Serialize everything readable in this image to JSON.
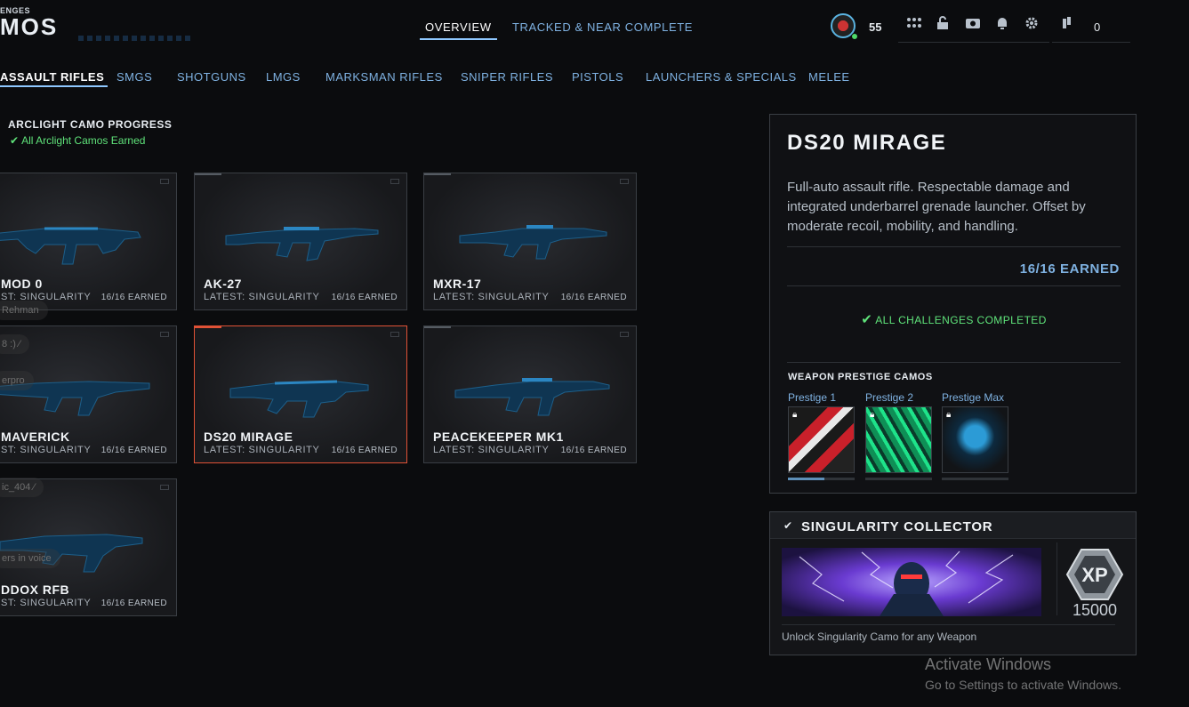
{
  "header": {
    "brand_top": "ENGES",
    "brand_main": "MOS",
    "tabs": [
      {
        "label": "OVERVIEW",
        "active": true
      },
      {
        "label": "TRACKED & NEAR COMPLETE",
        "active": false
      }
    ],
    "level": "55",
    "points": "0",
    "icons": [
      "profile-avatar",
      "grid-icon",
      "lock-open-icon",
      "camera-icon",
      "bell-icon",
      "gear-icon",
      "points-icon"
    ]
  },
  "categories": [
    {
      "label": "ASSAULT RIFLES",
      "active": true
    },
    {
      "label": "SMGS",
      "active": false
    },
    {
      "label": "SHOTGUNS",
      "active": false
    },
    {
      "label": "LMGS",
      "active": false
    },
    {
      "label": "MARKSMAN RIFLES",
      "active": false
    },
    {
      "label": "SNIPER RIFLES",
      "active": false
    },
    {
      "label": "PISTOLS",
      "active": false
    },
    {
      "label": "LAUNCHERS & SPECIALS",
      "active": false
    },
    {
      "label": "MELEE",
      "active": false
    }
  ],
  "progress": {
    "title": "ARCLIGHT CAMO PROGRESS",
    "status": "All Arclight Camos Earned"
  },
  "weapons": [
    {
      "name": "MOD 0",
      "latest": "ST: SINGULARITY",
      "earned": "16/16 EARNED"
    },
    {
      "name": "AK-27",
      "latest": "LATEST: SINGULARITY",
      "earned": "16/16 EARNED"
    },
    {
      "name": "MXR-17",
      "latest": "LATEST: SINGULARITY",
      "earned": "16/16 EARNED"
    },
    {
      "name": "MAVERICK",
      "latest": "ST: SINGULARITY",
      "earned": "16/16 EARNED"
    },
    {
      "name": "DS20 MIRAGE",
      "latest": "LATEST: SINGULARITY",
      "earned": "16/16 EARNED",
      "selected": true
    },
    {
      "name": "PEACEKEEPER MK1",
      "latest": "LATEST: SINGULARITY",
      "earned": "16/16 EARNED"
    },
    {
      "name": "DDOX RFB",
      "latest": "ST: SINGULARITY",
      "earned": "16/16 EARNED"
    }
  ],
  "overlays": [
    "Rehman",
    "8 :)",
    "erpro",
    "ic_404",
    "ers in voice"
  ],
  "detail": {
    "title": "DS20 MIRAGE",
    "description": "Full-auto assault rifle. Respectable damage and integrated underbarrel grenade launcher. Offset by moderate recoil, mobility, and handling.",
    "earned": "16/16 EARNED",
    "challenges": "ALL CHALLENGES COMPLETED",
    "prestige_heading": "WEAPON PRESTIGE CAMOS",
    "prestige": [
      {
        "label": "Prestige 1",
        "progress": 0.55
      },
      {
        "label": "Prestige 2",
        "progress": 0
      },
      {
        "label": "Prestige Max",
        "progress": 0
      }
    ]
  },
  "challenge": {
    "title": "SINGULARITY COLLECTOR",
    "description": "Unlock Singularity Camo for any Weapon",
    "xp_label": "XP",
    "xp_value": "15000"
  },
  "watermark": {
    "title": "Activate Windows",
    "subtitle": "Go to Settings to activate Windows."
  },
  "colors": {
    "accent": "#7fb2e2",
    "success": "#5fe37a",
    "selected": "#e05236"
  }
}
